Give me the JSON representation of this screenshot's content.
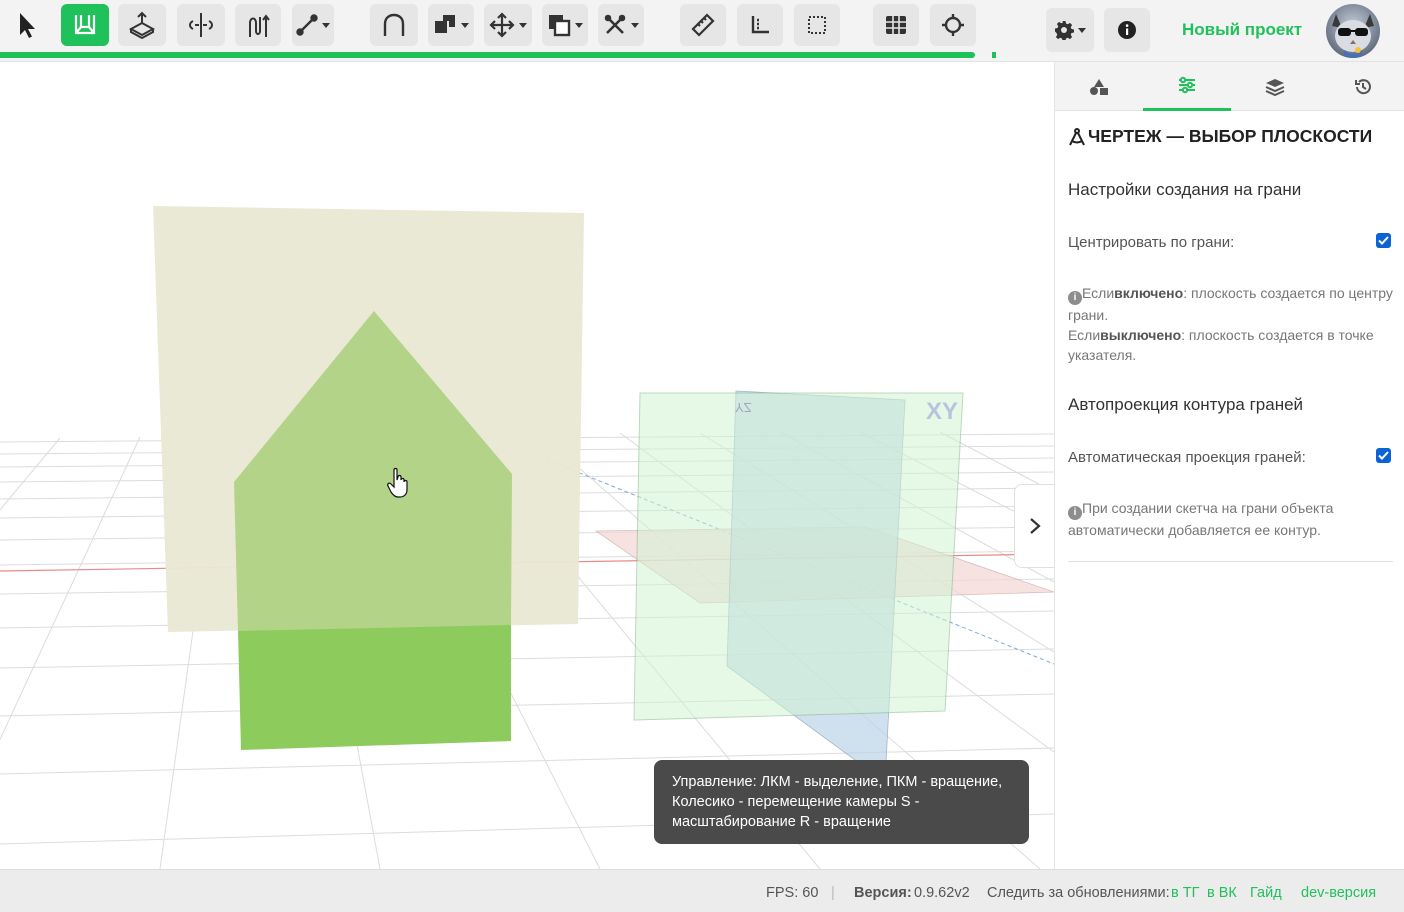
{
  "toolbar": {
    "tools": [
      {
        "id": "select",
        "icon": "cursor-arrow-icon"
      },
      {
        "id": "sketch",
        "icon": "sketch-icon",
        "active": true
      },
      {
        "id": "extrude",
        "icon": "extrude-icon"
      },
      {
        "id": "revolve",
        "icon": "revolve-icon"
      },
      {
        "id": "sweep",
        "icon": "sweep-icon"
      },
      {
        "id": "line",
        "icon": "line-tool-icon",
        "dropdown": true
      },
      {
        "id": "fillet",
        "icon": "fillet-icon"
      },
      {
        "id": "shapes",
        "icon": "shapes-icon",
        "dropdown": true
      },
      {
        "id": "move",
        "icon": "move-arrows-icon",
        "dropdown": true
      },
      {
        "id": "boolean",
        "icon": "boolean-icon",
        "dropdown": true
      },
      {
        "id": "tools",
        "icon": "wrench-tools-icon",
        "dropdown": true
      },
      {
        "id": "measure",
        "icon": "ruler-icon"
      },
      {
        "id": "angle",
        "icon": "angle-ruler-icon"
      },
      {
        "id": "bounds",
        "icon": "bounding-box-icon"
      },
      {
        "id": "grid",
        "icon": "grid-icon"
      },
      {
        "id": "snap",
        "icon": "crosshair-icon"
      }
    ],
    "progress": 0.98,
    "settings_icon": "gear-icon",
    "info_icon": "info-icon",
    "project_title": "Новый проект",
    "accent": "#1fc15b"
  },
  "viewport": {
    "axis_labels": {
      "xy": "XY",
      "yz": "YZ"
    },
    "tooltip": "Управление: ЛКМ - выделение, ПКМ - вращение, Колесико - перемещение камеры S - масштабирование R - вращение"
  },
  "panel": {
    "tabs": [
      {
        "id": "objects",
        "icon": "shapes-tab-icon"
      },
      {
        "id": "settings",
        "icon": "sliders-tab-icon",
        "active": true
      },
      {
        "id": "layers",
        "icon": "layers-tab-icon"
      },
      {
        "id": "history",
        "icon": "history-tab-icon"
      }
    ],
    "heading": "ЧЕРТЕЖ — ВЫБОР ПЛОСКОСТИ",
    "section1": {
      "title": "Настройки создания на грани",
      "option_label": "Центрировать по грани:",
      "checked": true,
      "hint_prefix1": "Если",
      "hint_bold1": "включено",
      "hint_rest1": ": плоскость создается по центру грани.",
      "hint_prefix2": "Если",
      "hint_bold2": "выключено",
      "hint_rest2": ": плоскость создается в точке указателя."
    },
    "section2": {
      "title": "Автопроекция контура граней",
      "option_label": "Автоматическая проекция граней:",
      "checked": true,
      "hint": "При создании скетча на грани объекта автоматически добавляется ее контур."
    }
  },
  "status": {
    "fps": "FPS: 60",
    "separator": "|",
    "version_label": "Версия:",
    "version_value": "0.9.62v2",
    "follow": "Следить за обновлениями:",
    "links": [
      "в ТГ",
      "в ВК",
      "Гайд",
      "dev-версия"
    ]
  }
}
